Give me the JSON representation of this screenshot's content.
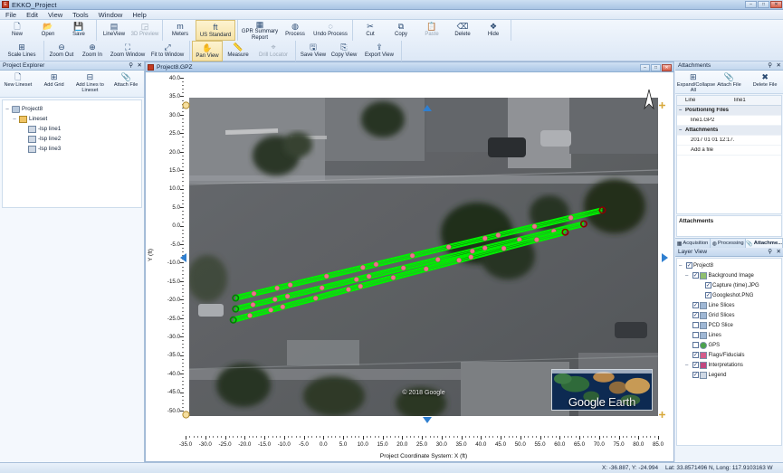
{
  "window": {
    "title": "EKKO_Project",
    "min_label": "–",
    "max_label": "□",
    "close_label": "✕"
  },
  "menubar": {
    "items": [
      "File",
      "Edit",
      "View",
      "Tools",
      "Window",
      "Help"
    ]
  },
  "ribbon": {
    "row1": [
      {
        "label": "New",
        "icon": "new-file-icon",
        "state": "normal"
      },
      {
        "label": "Open",
        "icon": "open-folder-icon",
        "state": "normal"
      },
      {
        "label": "Save",
        "icon": "save-disk-icon",
        "state": "normal"
      },
      {
        "label": "LineView",
        "icon": "lineview-icon",
        "state": "normal"
      },
      {
        "label": "3D Preview",
        "icon": "cube-icon",
        "state": "disabled"
      },
      {
        "label": "Meters",
        "icon": "meters-icon",
        "state": "normal"
      },
      {
        "label": "US Standard",
        "icon": "feet-icon",
        "state": "selected"
      },
      {
        "label": "GPR Summary Report",
        "icon": "report-icon",
        "state": "normal"
      },
      {
        "label": "Process",
        "icon": "process-icon",
        "state": "normal"
      },
      {
        "label": "Undo Process",
        "icon": "undo-process-icon",
        "state": "normal"
      },
      {
        "label": "Cut",
        "icon": "scissors-icon",
        "state": "normal"
      },
      {
        "label": "Copy",
        "icon": "copy-icon",
        "state": "normal"
      },
      {
        "label": "Paste",
        "icon": "paste-icon",
        "state": "disabled"
      },
      {
        "label": "Delete",
        "icon": "delete-icon",
        "state": "normal"
      },
      {
        "label": "Hide",
        "icon": "hide-icon",
        "state": "normal"
      }
    ],
    "row2": [
      {
        "label": "Scale Lines",
        "icon": "scale-lines-icon",
        "state": "normal"
      },
      {
        "label": "Zoom Out",
        "icon": "zoom-out-icon",
        "state": "normal"
      },
      {
        "label": "Zoom In",
        "icon": "zoom-in-icon",
        "state": "normal"
      },
      {
        "label": "Zoom Window",
        "icon": "zoom-window-icon",
        "state": "normal"
      },
      {
        "label": "Fit to Window",
        "icon": "fit-window-icon",
        "state": "normal"
      },
      {
        "label": "Pan View",
        "icon": "pan-hand-icon",
        "state": "selected"
      },
      {
        "label": "Measure",
        "icon": "measure-ruler-icon",
        "state": "normal"
      },
      {
        "label": "Drill Locator",
        "icon": "drill-locator-icon",
        "state": "disabled"
      },
      {
        "label": "Save View",
        "icon": "save-view-icon",
        "state": "normal"
      },
      {
        "label": "Copy View",
        "icon": "copy-view-icon",
        "state": "normal"
      },
      {
        "label": "Export View",
        "icon": "export-view-icon",
        "state": "normal"
      }
    ]
  },
  "project_explorer": {
    "title": "Project Explorer",
    "tools": [
      {
        "label": "New Lineset",
        "icon": "new-lineset-icon"
      },
      {
        "label": "Add Grid",
        "icon": "add-grid-icon"
      },
      {
        "label": "Add Lines to Lineset",
        "icon": "add-lines-icon"
      },
      {
        "label": "Attach File",
        "icon": "attach-file-icon"
      }
    ],
    "tree": [
      {
        "label": "Project8",
        "depth": 0,
        "icon": "project-icon",
        "expander": "–"
      },
      {
        "label": "Lineset",
        "depth": 1,
        "icon": "folder-icon",
        "expander": "–"
      },
      {
        "label": "line1",
        "depth": 2,
        "icon": "line-icon",
        "prefix": "-lsp",
        "expander": ""
      },
      {
        "label": "line2",
        "depth": 2,
        "icon": "line-icon",
        "prefix": "-lsp",
        "expander": ""
      },
      {
        "label": "line3",
        "depth": 2,
        "icon": "line-icon",
        "prefix": "-lsp",
        "expander": ""
      }
    ]
  },
  "document": {
    "title": "Project8.GPZ",
    "min_label": "–",
    "max_label": "□",
    "close_label": "✕"
  },
  "attachments_panel": {
    "title": "Attachments",
    "tools": [
      {
        "label": "Expand/Collapse All",
        "icon": "expand-collapse-icon"
      },
      {
        "label": "Attach File",
        "icon": "attach-file-icon"
      },
      {
        "label": "Delete File",
        "icon": "delete-file-icon"
      }
    ],
    "columns": [
      "Line",
      "line1"
    ],
    "rows": [
      {
        "kind": "group",
        "label": "Positioning Files",
        "value": ""
      },
      {
        "kind": "item",
        "label": "line1.GP2",
        "value": ""
      },
      {
        "kind": "group",
        "label": "Attachments",
        "value": ""
      },
      {
        "kind": "item",
        "label": "2017 01 01 12:17...",
        "value": ""
      },
      {
        "kind": "item",
        "label": "Add a file",
        "value": ""
      }
    ],
    "summary_label": "Attachments",
    "tabs": [
      {
        "label": "Acquisition",
        "icon": "acquisition-icon",
        "active": false
      },
      {
        "label": "Processing",
        "icon": "processing-icon",
        "active": false
      },
      {
        "label": "Attachme...",
        "icon": "attachments-icon",
        "active": true
      }
    ]
  },
  "layer_view": {
    "title": "Layer View",
    "items": [
      {
        "label": "Project8",
        "depth": 0,
        "checked": true,
        "icon": "project-icon",
        "expander": "–"
      },
      {
        "label": "Background Image",
        "depth": 1,
        "checked": true,
        "icon": "image-icon",
        "expander": "–"
      },
      {
        "label": "Capture (time).JPG",
        "depth": 3,
        "checked": true,
        "icon": "document-icon",
        "expander": ""
      },
      {
        "label": "Googleshot.PNG",
        "depth": 3,
        "checked": true,
        "icon": "document-icon",
        "expander": ""
      },
      {
        "label": "Line Slices",
        "depth": 1,
        "checked": true,
        "icon": "slice-icon",
        "expander": ""
      },
      {
        "label": "Grid Slices",
        "depth": 1,
        "checked": true,
        "icon": "slice-icon",
        "expander": ""
      },
      {
        "label": "PCD Slice",
        "depth": 1,
        "checked": false,
        "icon": "slice-icon",
        "expander": ""
      },
      {
        "label": "Lines",
        "depth": 1,
        "checked": false,
        "icon": "lines-icon",
        "expander": ""
      },
      {
        "label": "GPS",
        "depth": 1,
        "checked": false,
        "icon": "gps-icon",
        "expander": ""
      },
      {
        "label": "Flags/Fiducials",
        "depth": 1,
        "checked": true,
        "icon": "flag-icon",
        "expander": ""
      },
      {
        "label": "Interpretations",
        "depth": 1,
        "checked": true,
        "icon": "interpretation-icon",
        "expander": "–"
      },
      {
        "label": "Legend",
        "depth": 1,
        "checked": true,
        "icon": "legend-icon",
        "expander": ""
      }
    ]
  },
  "plot": {
    "x_axis_label": "Project Coordinate System: X (ft)",
    "y_axis_label": "Y (ft)",
    "x_ticks": [
      "-35.0",
      "-30.0",
      "-25.0",
      "-20.0",
      "-15.0",
      "-10.0",
      "-5.0",
      "0.0",
      "5.0",
      "10.0",
      "15.0",
      "20.0",
      "25.0",
      "30.0",
      "35.0",
      "40.0",
      "45.0",
      "50.0",
      "55.0",
      "60.0",
      "65.0",
      "70.0",
      "75.0",
      "80.0",
      "85.0"
    ],
    "y_ticks": [
      "40.0",
      "35.0",
      "30.0",
      "25.0",
      "20.0",
      "15.0",
      "10.0",
      "5.0",
      "0.0",
      "-5.0",
      "-10.0",
      "-15.0",
      "-20.0",
      "-25.0",
      "-30.0",
      "-35.0",
      "-40.0",
      "-45.0",
      "-50.0"
    ],
    "basemap_attribution": "© 2018 Google",
    "basemap_logo_primary": "Google",
    "basemap_logo_secondary": "Earth"
  },
  "chart_data": {
    "type": "scatter",
    "title": "Project8.GPZ",
    "xlabel": "Project Coordinate System: X (ft)",
    "ylabel": "Y (ft)",
    "xlim": [
      -37,
      87
    ],
    "ylim": [
      -52,
      42
    ],
    "grid": false,
    "legend_position": "none",
    "series": [
      {
        "name": "line1",
        "color": "#00ee00",
        "x": [
          -13.0,
          66.0
        ],
        "y": [
          -6.5,
          9.5
        ]
      },
      {
        "name": "line2",
        "color": "#00ee00",
        "x": [
          -13.0,
          62.0
        ],
        "y": [
          -8.5,
          7.0
        ]
      },
      {
        "name": "line3",
        "color": "#00ee00",
        "x": [
          -13.5,
          58.0
        ],
        "y": [
          -10.5,
          5.5
        ]
      }
    ],
    "markers": {
      "name": "Flags/Fiducials",
      "color": "#f0708f",
      "count": 36
    },
    "start_markers": {
      "name": "line start",
      "color": "#008000",
      "count": 3
    },
    "end_markers": {
      "name": "line end",
      "color": "#8b0000",
      "count": 3
    }
  },
  "status_bar": {
    "cursor_position": "X: -36.887, Y: -24.994",
    "geo_position": "Lat: 33.8571496 N, Long: 117.9103163 W"
  }
}
